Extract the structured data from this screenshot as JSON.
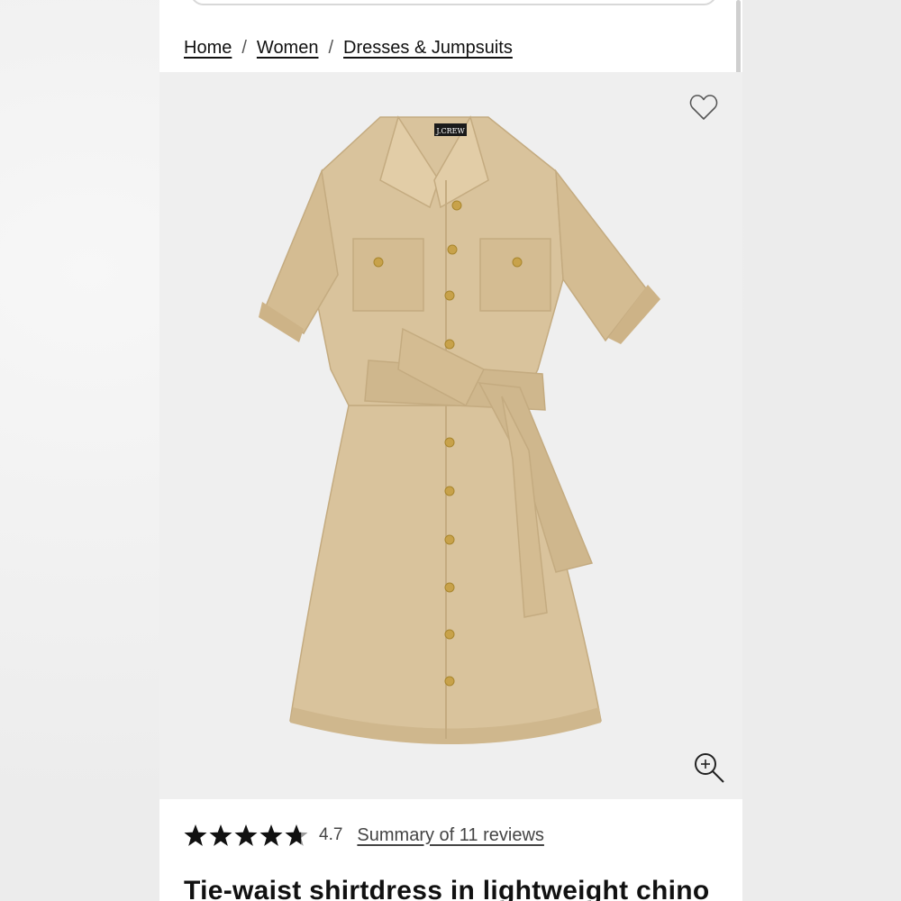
{
  "breadcrumb": {
    "home": "Home",
    "women": "Women",
    "dresses": "Dresses & Jumpsuits",
    "separator": "/"
  },
  "product": {
    "brand_label": "J.CREW",
    "image_alt": "Tie-waist shirtdress in lightweight chino",
    "title": "Tie-waist shirtdress in lightweight chino",
    "rating": "4.7",
    "rating_stars": 4.7,
    "reviews_link": "Summary of 11 reviews",
    "colors": {
      "dress": "#d9c39c",
      "dress_shadow": "#c9b186",
      "buttons": "#c8a24a"
    }
  },
  "icons": {
    "favorite": "heart-outline-icon",
    "zoom": "zoom-in-icon",
    "star": "star-icon"
  }
}
